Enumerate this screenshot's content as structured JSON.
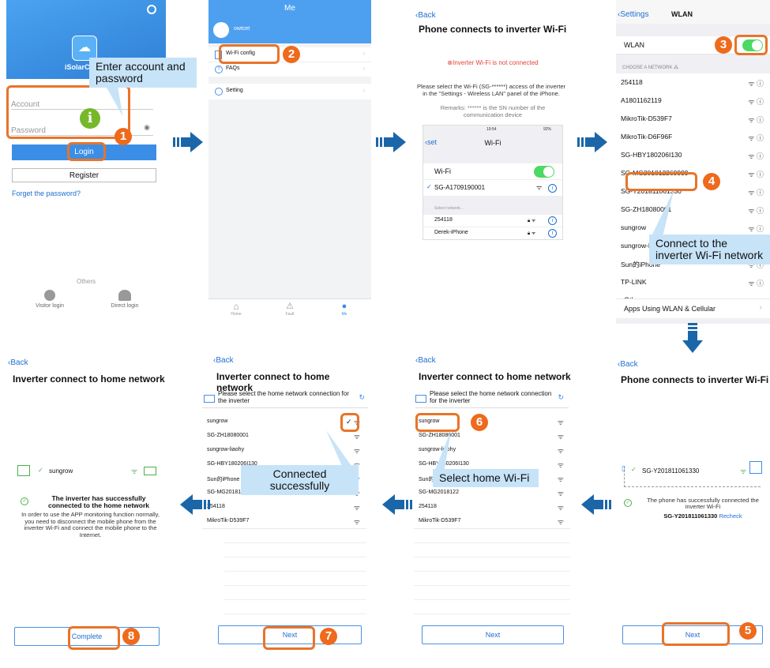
{
  "colors": {
    "accent": "#e8742a",
    "step": "#ee6a1c",
    "blue": "#1e6fd0",
    "callout": "#c7e3f8",
    "arrow": "#1b66a8",
    "appBlue": "#3b8ee6"
  },
  "steps": [
    "1",
    "2",
    "3",
    "4",
    "5",
    "6",
    "7",
    "8"
  ],
  "s1": {
    "app_name": "iSolarC",
    "account_placeholder": "Account",
    "password_placeholder": "Password",
    "login_label": "Login",
    "register_label": "Register",
    "forget_label": "Forget the password?",
    "others_label": "Others",
    "visitor_label": "Visitor login",
    "direct_label": "Direct login",
    "callout": "Enter account and password",
    "icons": [
      "settings-icon",
      "cloud-sun-icon",
      "info-icon",
      "eye-icon"
    ]
  },
  "s2": {
    "title": "Me",
    "username": "owtcet",
    "menu": [
      "Wi-Fi config",
      "FAQs",
      "Setting"
    ],
    "tabs": [
      "Home",
      "Fault",
      "Me"
    ]
  },
  "s3": {
    "back": "Back",
    "title": "Phone connects to inverter Wi-Fi",
    "status": "Inverter Wi-Fi is not connected",
    "instruction": "Please select the Wi-Fi (SG-******) access of the inverter in the \"Settings - Wireless LAN\" panel of the iPhone.",
    "remarks": "Remarks: ****** is the SN number of the communication device",
    "phone": {
      "time": "19:54",
      "battery": "92%",
      "back": "set",
      "title": "Wi-Fi",
      "wifi_label": "Wi-Fi",
      "connected": "SG-A1709190001",
      "section": "Select network...",
      "networks": [
        "254118",
        "Derek-iPhone"
      ]
    }
  },
  "s4": {
    "back": "Settings",
    "title": "WLAN",
    "wlan_label": "WLAN",
    "section": "CHOOSE A NETWORK",
    "networks": [
      "254118",
      "A1801162119",
      "MikroTik-D539F7",
      "MikroTik-D6F96F",
      "SG-HBY180206I130",
      "SG-MG201812269999",
      "SG-Y201811061330",
      "SG-ZH18080001",
      "sungrow",
      "sungrow-liaohy",
      "Sun的iPhone",
      "TP-LINK"
    ],
    "other": "Other...",
    "apps": "Apps Using WLAN & Cellular",
    "callout": "Connect to the inverter Wi-Fi network"
  },
  "s5": {
    "back": "Back",
    "title": "Phone connects to inverter Wi-Fi",
    "ssid": "SG-Y201811061330",
    "success": "The phone has successfully connected the inverter Wi-Fi",
    "ssid2": "SG-Y201811061330",
    "recheck": "Recheck",
    "next": "Next"
  },
  "s6": {
    "back": "Back",
    "title": "Inverter connect to home network",
    "header": "Please select the home network connection for the inverter",
    "networks": [
      "sungrow",
      "SG-ZH18080001",
      "sungrow-liaohy",
      "SG-HBY180206I130",
      "Sun的iPhone",
      "SG-MG2018122",
      "254118",
      "MikroTik-D539F7"
    ],
    "callout": "Select home Wi-Fi",
    "next": "Next"
  },
  "s7": {
    "back": "Back",
    "title": "Inverter connect to home network",
    "header": "Please select the home network connection for the inverter",
    "networks": [
      "sungrow",
      "SG-ZH18080001",
      "sungrow-liaohy",
      "SG-HBY180206I130",
      "Sun的iPhone",
      "SG-MG2018122",
      "254118",
      "MikroTik-D539F7"
    ],
    "callout": "Connected successfully",
    "next": "Next"
  },
  "s8": {
    "back": "Back",
    "title": "Inverter connect to home network",
    "ssid": "sungrow",
    "success": "The inverter has successfully connected to the home network",
    "note": "In order to use the APP monitoring function normally, you need to disconnect the mobile phone from the inverter Wi-Fi and connect the mobile phone to the Internet.",
    "complete": "Complete"
  }
}
